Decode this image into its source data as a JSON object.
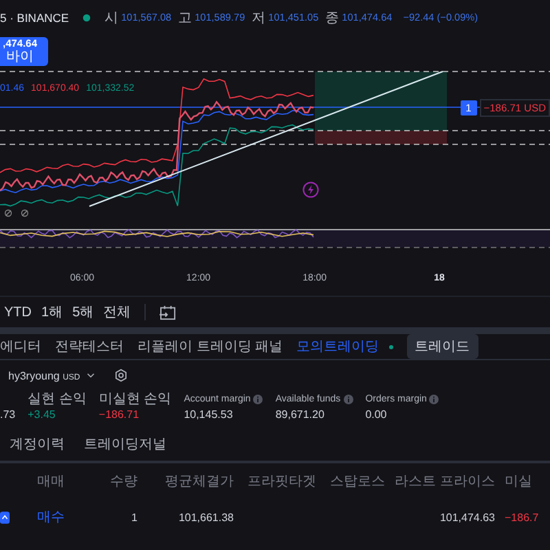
{
  "header": {
    "symbol": "5 · BINANCE",
    "ohlc": [
      {
        "label": "시",
        "value": "101,567.08"
      },
      {
        "label": "고",
        "value": "101,589.79"
      },
      {
        "label": "저",
        "value": "101,451.05"
      },
      {
        "label": "종",
        "value": "101,474.64"
      }
    ],
    "change": "−92.44 (−0.09%)"
  },
  "buy_button": {
    "price": ",474.64",
    "label": "바이"
  },
  "bollinger": [
    {
      "value": "01.46",
      "color": "#2962ff"
    },
    {
      "value": "101,670.40",
      "color": "#f23645"
    },
    {
      "value": "101,332.52",
      "color": "#089981"
    }
  ],
  "position_label": {
    "quantity": "1",
    "pnl": "−186.71 USD"
  },
  "time_axis": [
    {
      "label": "06:00",
      "bold": false
    },
    {
      "label": "12:00",
      "bold": false
    },
    {
      "label": "18:00",
      "bold": false
    },
    {
      "label": "18",
      "bold": true
    }
  ],
  "ranges": [
    "YTD",
    "1해",
    "5해",
    "전체"
  ],
  "panel_tabs": [
    {
      "label": "에디터",
      "kind": "tab",
      "selected": false,
      "online": false
    },
    {
      "label": "전략테스터",
      "kind": "tab",
      "selected": false,
      "online": false
    },
    {
      "label": "리플레이 트레이딩 패널",
      "kind": "tab",
      "selected": false,
      "online": false
    },
    {
      "label": "모의트레이딩",
      "kind": "tab",
      "selected": true,
      "online": true
    },
    {
      "label": "트레이드",
      "kind": "button",
      "selected": false,
      "online": false
    }
  ],
  "account": {
    "name": "hy3ryoung",
    "currency": "USD"
  },
  "metrics": [
    {
      "value": ".73",
      "color": "#d1d4dc",
      "info": false
    },
    {
      "label": "실현 손익",
      "value": "+3.45",
      "color": "#089981",
      "info": false
    },
    {
      "label": "미실현 손익",
      "value": "−186.71",
      "color": "#f23645",
      "info": false
    },
    {
      "label": "Account margin",
      "value": "10,145.53",
      "color": "#d1d4dc",
      "info": true
    },
    {
      "label": "Available funds",
      "value": "89,671.20",
      "color": "#d1d4dc",
      "info": true
    },
    {
      "label": "Orders margin",
      "value": "0.00",
      "color": "#d1d4dc",
      "info": true
    }
  ],
  "sub_tabs": [
    "계정이력",
    "트레이딩저널"
  ],
  "table": {
    "columns": [
      "매매",
      "수량",
      "평균체결가",
      "프라핏타겟",
      "스탑로스",
      "라스트 프라이스",
      "미실"
    ],
    "rows": [
      {
        "side": "매수",
        "quantity": "1",
        "avg_price": "101,661.38",
        "last_price": "101,474.63",
        "unrealized": "−186.7"
      }
    ]
  }
}
